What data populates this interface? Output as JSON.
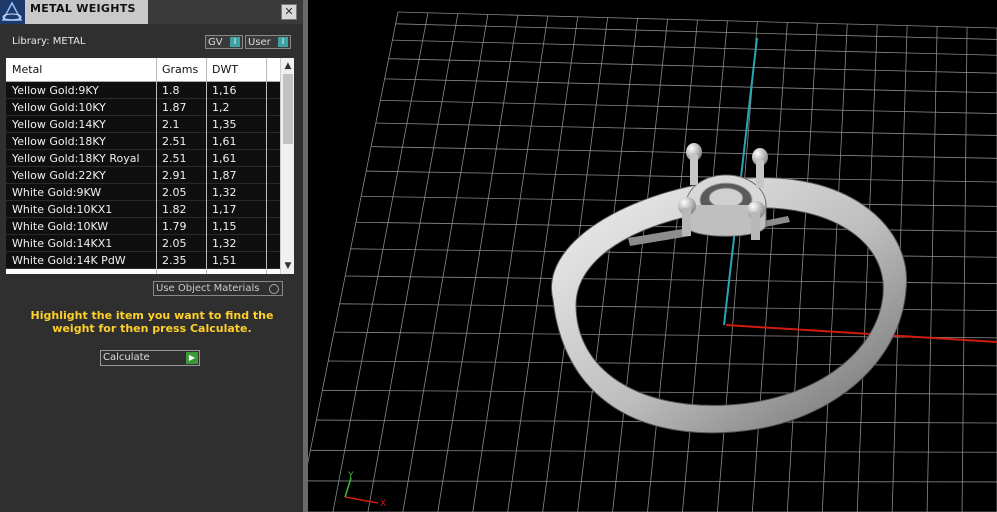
{
  "panel": {
    "title": "METAL WEIGHTS",
    "close_glyph": "✕",
    "library_label": "Library: METAL",
    "toggles": {
      "gv": "GV",
      "user": "User",
      "knob": "I"
    },
    "table": {
      "headers": {
        "metal": "Metal",
        "grams": "Grams",
        "dwt": "DWT"
      },
      "rows": [
        {
          "metal": "Yellow Gold:9KY",
          "grams": "1.8",
          "dwt": "1,16"
        },
        {
          "metal": "Yellow Gold:10KY",
          "grams": "1.87",
          "dwt": "1,2"
        },
        {
          "metal": "Yellow Gold:14KY",
          "grams": "2.1",
          "dwt": "1,35"
        },
        {
          "metal": "Yellow Gold:18KY",
          "grams": "2.51",
          "dwt": "1,61"
        },
        {
          "metal": "Yellow Gold:18KY Royal",
          "grams": "2.51",
          "dwt": "1,61"
        },
        {
          "metal": "Yellow Gold:22KY",
          "grams": "2.91",
          "dwt": "1,87"
        },
        {
          "metal": "White Gold:9KW",
          "grams": "2.05",
          "dwt": "1,32"
        },
        {
          "metal": "White Gold:10KX1",
          "grams": "1.82",
          "dwt": "1,17"
        },
        {
          "metal": "White Gold:10KW",
          "grams": "1.79",
          "dwt": "1,15"
        },
        {
          "metal": "White Gold:14KX1",
          "grams": "2.05",
          "dwt": "1,32"
        },
        {
          "metal": "White Gold:14K PdW",
          "grams": "2.35",
          "dwt": "1,51"
        }
      ]
    },
    "use_object_materials": "Use Object Materials",
    "hint": "Highlight the item you want to find the weight for then press Calculate.",
    "calculate_label": "Calculate"
  },
  "viewport": {
    "axis_x_label": "X",
    "axis_y_label": "Y",
    "colors": {
      "grid": "#8a8a8a",
      "y_axis": "#2aa6b0",
      "x_axis": "#d01c10",
      "ring": "#c8c8c8"
    }
  }
}
